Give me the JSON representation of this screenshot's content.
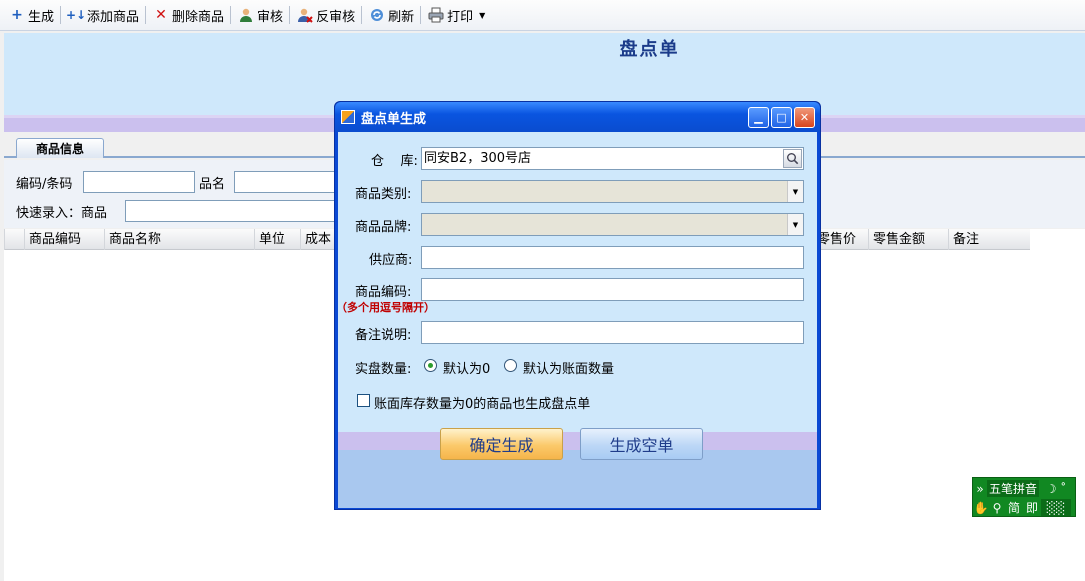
{
  "toolbar": {
    "items": [
      {
        "label": "生成",
        "icon": "plus-icon"
      },
      {
        "label": "添加商品",
        "icon": "add-item-icon"
      },
      {
        "label": "删除商品",
        "icon": "delete-icon"
      },
      {
        "label": "审核",
        "icon": "user-approve-icon"
      },
      {
        "label": "反审核",
        "icon": "user-reject-icon"
      },
      {
        "label": "刷新",
        "icon": "refresh-icon"
      },
      {
        "label": "打印",
        "icon": "printer-icon"
      }
    ]
  },
  "document": {
    "title": "盘点单"
  },
  "tabs": {
    "goods_info": "商品信息"
  },
  "filter": {
    "code_label": "编码/条码",
    "code_value": "",
    "name_label": "品名",
    "name_value": "",
    "quick_label": "快速录入：商品",
    "quick_value": ""
  },
  "grid": {
    "columns": [
      "商品编码",
      "商品名称",
      "单位",
      "成本",
      "零售价",
      "零售金额",
      "备注"
    ]
  },
  "dialog": {
    "title": "盘点单生成",
    "warehouse_label": "仓    库:",
    "warehouse_value": "同安B2，300号店",
    "category_label": "商品类别:",
    "category_value": "",
    "brand_label": "商品品牌:",
    "brand_value": "",
    "supplier_label": "供应商:",
    "supplier_value": "",
    "code_label": "商品编码:",
    "code_value": "",
    "code_hint": "（多个用逗号隔开）",
    "remark_label": "备注说明:",
    "remark_value": "",
    "qty_label": "实盘数量:",
    "qty_option_zero": "默认为0",
    "qty_option_book": "默认为账面数量",
    "qty_selected": "默认为0",
    "zero_stock_check_label": "账面库存数量为0的商品也生成盘点单",
    "zero_stock_checked": false,
    "confirm_button": "确定生成",
    "empty_button": "生成空单"
  },
  "ime": {
    "name": "五笔拼音",
    "mode": "简",
    "extra": "即"
  },
  "colors": {
    "header_bg": "#cfe8fb",
    "dialog_title": "#0a55e0",
    "hint_red": "#c00000",
    "ime_green": "#118822"
  }
}
